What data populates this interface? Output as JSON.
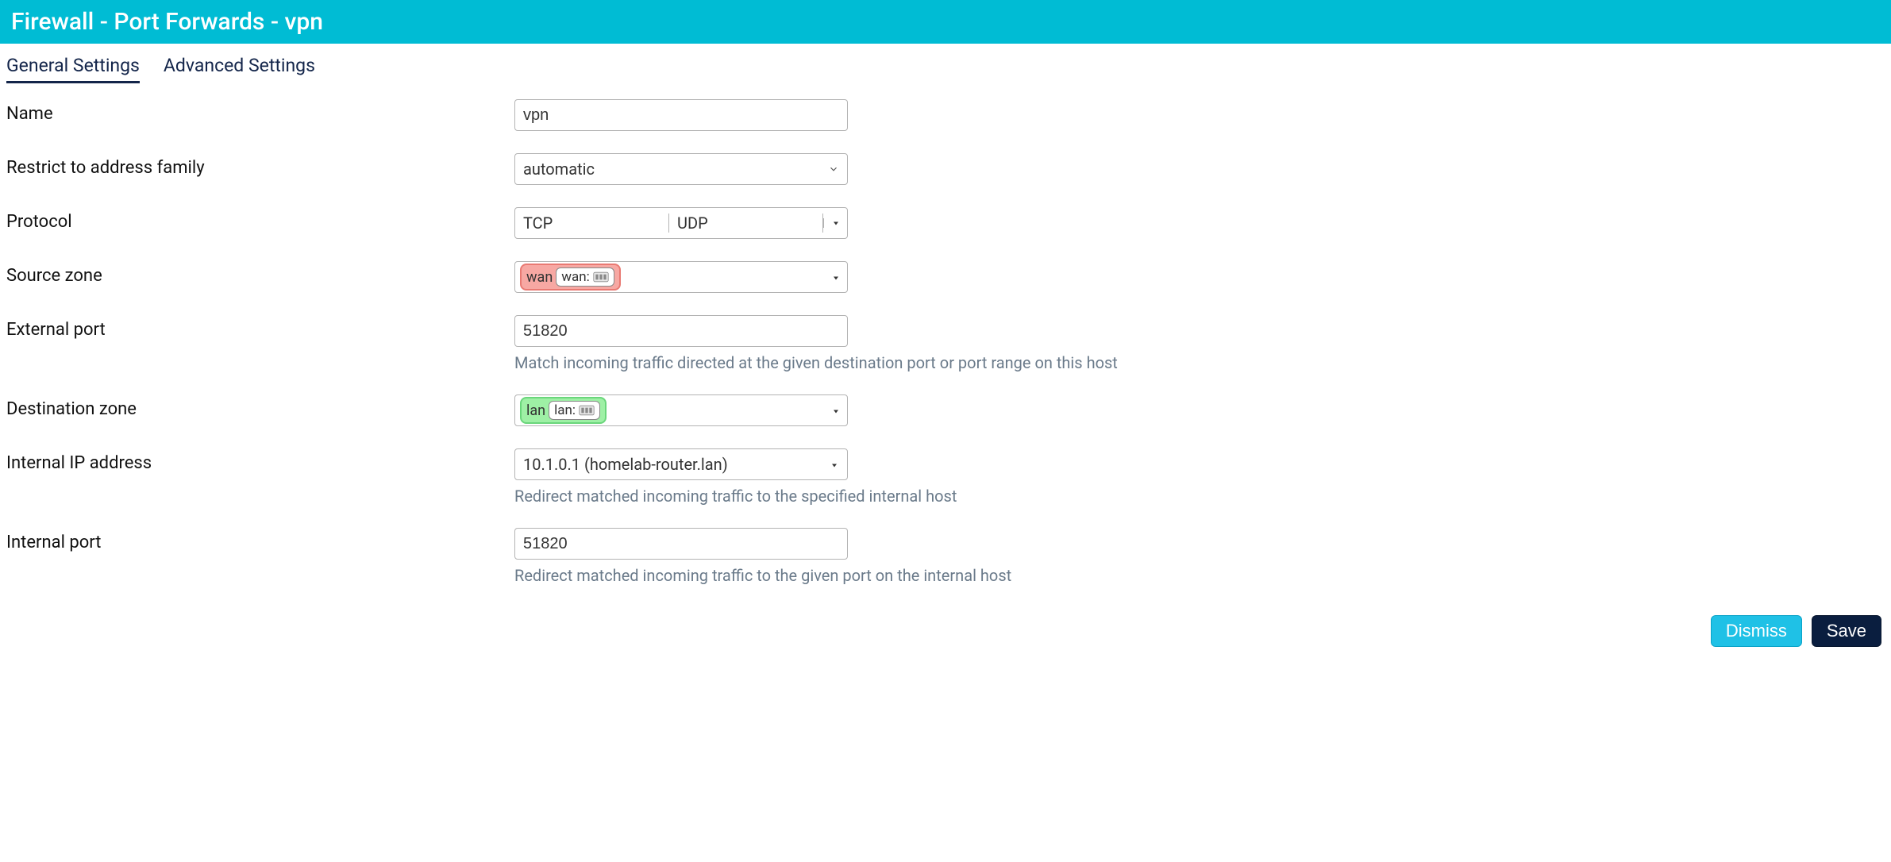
{
  "header": {
    "title": "Firewall - Port Forwards - vpn"
  },
  "tabs": {
    "general": "General Settings",
    "advanced": "Advanced Settings"
  },
  "labels": {
    "name": "Name",
    "family": "Restrict to address family",
    "protocol": "Protocol",
    "src_zone": "Source zone",
    "ext_port": "External port",
    "dst_zone": "Destination zone",
    "int_ip": "Internal IP address",
    "int_port": "Internal port"
  },
  "values": {
    "name": "vpn",
    "family": "automatic",
    "protocol": {
      "a": "TCP",
      "b": "UDP"
    },
    "src_zone": {
      "label": "wan",
      "badge": "wan:"
    },
    "ext_port": "51820",
    "dst_zone": {
      "label": "lan",
      "badge": "lan:"
    },
    "int_ip": "10.1.0.1 (homelab-router.lan)",
    "int_port": "51820"
  },
  "help": {
    "ext_port": "Match incoming traffic directed at the given destination port or port range on this host",
    "int_ip": "Redirect matched incoming traffic to the specified internal host",
    "int_port": "Redirect matched incoming traffic to the given port on the internal host"
  },
  "buttons": {
    "dismiss": "Dismiss",
    "save": "Save"
  }
}
